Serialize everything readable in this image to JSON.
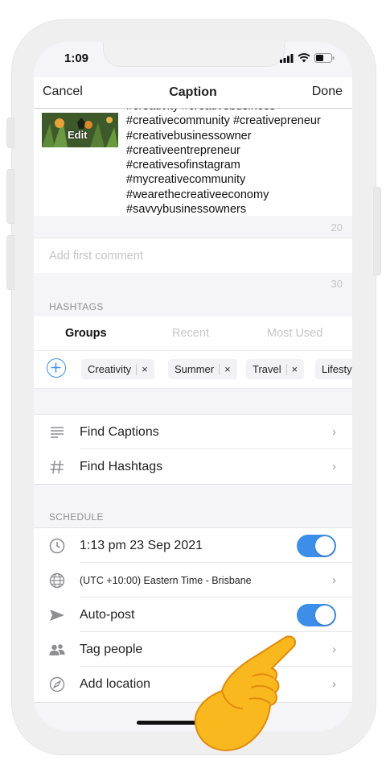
{
  "status_bar": {
    "time": "1:09"
  },
  "navbar": {
    "cancel": "Cancel",
    "title": "Caption",
    "done": "Done"
  },
  "caption": {
    "edit_label": "Edit",
    "text": "#creativity #creativebusiness\n#creativecommunity #creativepreneur\n#creativebusinessowner\n#creativeentrepreneur\n#creativesofinstagram\n#mycreativecommunity\n#wearethecreativeeconomy\n#savvybusinessowners",
    "count": "20"
  },
  "comment": {
    "placeholder": "Add first comment",
    "count": "30"
  },
  "hashtags": {
    "section_label": "HASHTAGS",
    "tabs": [
      {
        "label": "Groups"
      },
      {
        "label": "Recent"
      },
      {
        "label": "Most Used"
      }
    ],
    "chips": [
      {
        "label": "Creativity"
      },
      {
        "label": "Summer"
      },
      {
        "label": "Travel"
      },
      {
        "label": "Lifesty"
      }
    ],
    "remove_glyph": "×"
  },
  "tools": {
    "items": [
      {
        "label": "Find Captions"
      },
      {
        "label": "Find Hashtags"
      }
    ]
  },
  "schedule": {
    "section_label": "SCHEDULE",
    "datetime": "1:13 pm  23 Sep 2021",
    "timezone": "(UTC +10:00) Eastern Time - Brisbane",
    "autopost": "Auto-post",
    "tag_people": "Tag people",
    "add_location": "Add location",
    "datetime_toggle_on": true,
    "autopost_toggle_on": true
  },
  "chevron": "›",
  "colors": {
    "accent": "#3d8ee8",
    "background": "#f5f5f7",
    "icon_gray": "#8e8e93"
  }
}
